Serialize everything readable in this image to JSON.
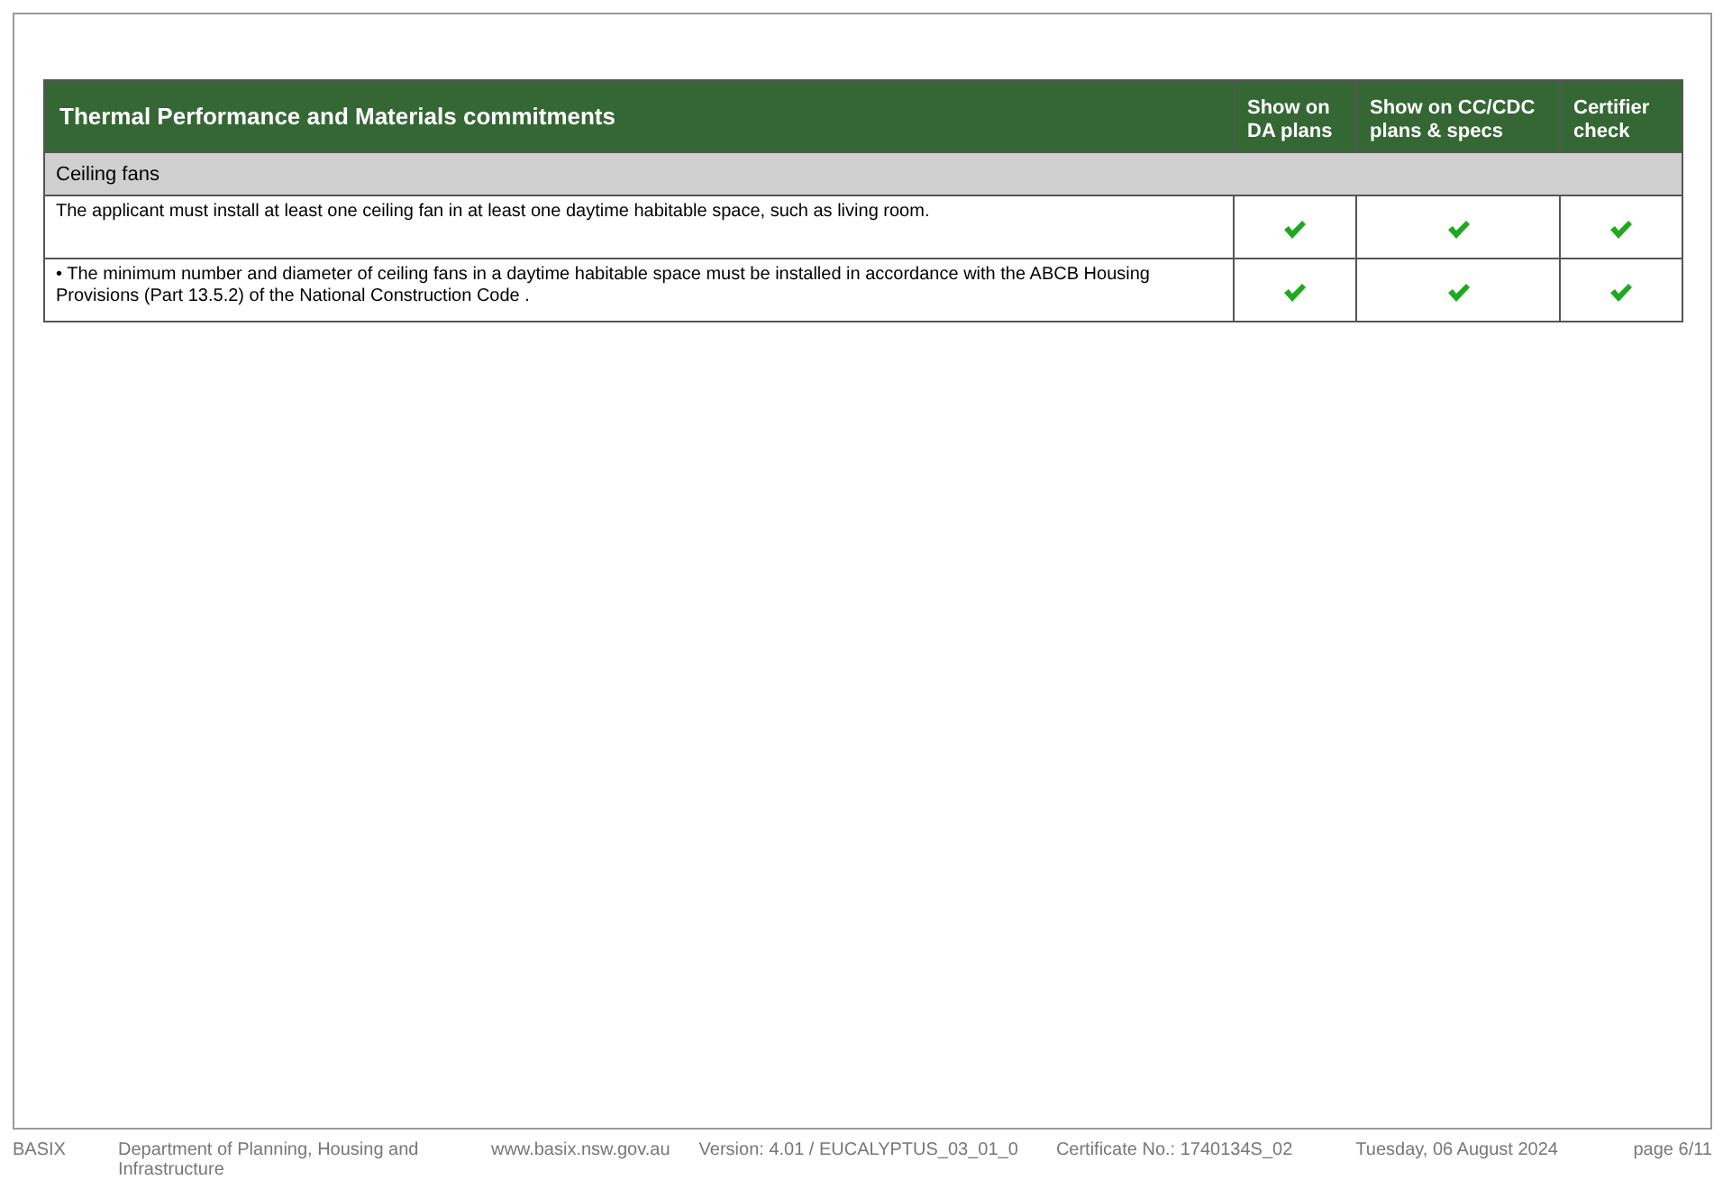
{
  "table": {
    "columns": [
      "Thermal Performance and Materials commitments",
      "Show on DA plans",
      "Show on CC/CDC plans & specs",
      "Certifier check"
    ],
    "section": "Ceiling fans",
    "rows": [
      {
        "text": "The applicant must install at least one ceiling fan in at least one daytime habitable space, such as living room.",
        "checks": [
          true,
          true,
          true
        ]
      },
      {
        "text": "• The minimum number and diameter of ceiling fans in a daytime habitable space must be installed in accordance with the ABCB Housing Provisions (Part 13.5.2) of the National Construction Code .",
        "checks": [
          true,
          true,
          true
        ]
      }
    ]
  },
  "footer": [
    "BASIX",
    "Department of Planning, Housing and Infrastructure",
    "www.basix.nsw.gov.au",
    "Version: 4.01 / EUCALYPTUS_03_01_0",
    "Certificate No.: 1740134S_02",
    "Tuesday, 06 August 2024",
    "page 6/11"
  ]
}
